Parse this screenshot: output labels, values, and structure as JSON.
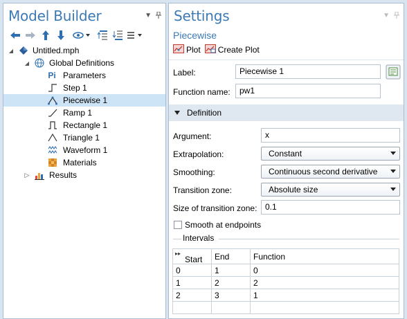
{
  "left": {
    "title": "Model Builder",
    "toolbar_icons": [
      "arrow-left-icon",
      "arrow-right-icon",
      "arrow-up-icon",
      "arrow-down-icon",
      "eye-icon",
      "collapse-tree-icon",
      "expand-tree-icon",
      "list-menu-icon"
    ],
    "tree": [
      {
        "label": "Untitled.mph",
        "icon": "model-icon",
        "toggle": "expanded"
      },
      {
        "label": "Global Definitions",
        "icon": "globe-icon",
        "toggle": "expanded"
      },
      {
        "label": "Parameters",
        "icon": "parameters-icon",
        "icon_text": "Pi"
      },
      {
        "label": "Step 1",
        "icon": "step-function-icon"
      },
      {
        "label": "Piecewise 1",
        "icon": "piecewise-function-icon",
        "selected": true
      },
      {
        "label": "Ramp 1",
        "icon": "ramp-function-icon"
      },
      {
        "label": "Rectangle 1",
        "icon": "rectangle-function-icon"
      },
      {
        "label": "Triangle 1",
        "icon": "triangle-function-icon"
      },
      {
        "label": "Waveform 1",
        "icon": "waveform-function-icon"
      },
      {
        "label": "Materials",
        "icon": "materials-icon"
      },
      {
        "label": "Results",
        "icon": "results-icon",
        "toggle": "collapsed"
      }
    ]
  },
  "right": {
    "title": "Settings",
    "subtitle": "Piecewise",
    "actions": {
      "plot": "Plot",
      "create_plot": "Create Plot"
    },
    "label_field": {
      "label": "Label:",
      "value": "Piecewise 1"
    },
    "function_name": {
      "label": "Function name:",
      "value": "pw1"
    },
    "section": "Definition",
    "argument": {
      "label": "Argument:",
      "value": "x"
    },
    "extrapolation": {
      "label": "Extrapolation:",
      "value": "Constant"
    },
    "smoothing": {
      "label": "Smoothing:",
      "value": "Continuous second derivative"
    },
    "transition_zone": {
      "label": "Transition zone:",
      "value": "Absolute size"
    },
    "transition_size": {
      "label": "Size of transition zone:",
      "value": "0.1"
    },
    "smooth_endpoints": {
      "label": "Smooth at endpoints",
      "checked": false
    },
    "intervals": {
      "label": "Intervals",
      "headers": [
        "Start",
        "End",
        "Function"
      ],
      "rows": [
        [
          "0",
          "1",
          "0"
        ],
        [
          "1",
          "2",
          "2"
        ],
        [
          "2",
          "3",
          "1"
        ],
        [
          "",
          "",
          ""
        ]
      ]
    }
  }
}
